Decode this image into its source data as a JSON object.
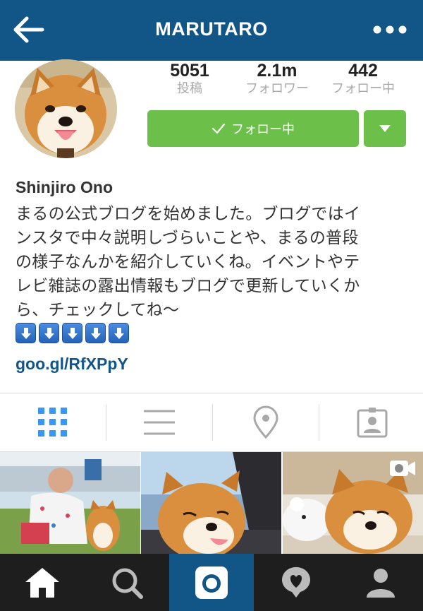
{
  "header": {
    "title": "MARUTARO",
    "back_icon": "arrow-left-icon",
    "more_icon": "more-dots-icon",
    "background": "#125688"
  },
  "profile": {
    "stats": [
      {
        "value": "5051",
        "label": "投稿"
      },
      {
        "value": "2.1m",
        "label": "フォロワー"
      },
      {
        "value": "442",
        "label": "フォロー中"
      }
    ],
    "follow_button": "フォロー中",
    "follow_color": "#6cc04a",
    "name": "Shinjiro Ono",
    "bio_lines": [
      "まるの公式ブログを始めました。ブログではイ",
      "ンスタで中々説明しづらいことや、まるの普段",
      "の様子なんかを紹介していくね。イベントやテ",
      "レビ雑誌の露出情報もブログで更新していくか",
      "ら、チェックしてね〜"
    ],
    "arrow_emoji_count": 5,
    "link": "goo.gl/RfXPpY",
    "link_color": "#125688"
  },
  "view_tabs": [
    {
      "icon": "grid-icon",
      "active": true
    },
    {
      "icon": "list-icon",
      "active": false
    },
    {
      "icon": "location-pin-icon",
      "active": false
    },
    {
      "icon": "tagged-photos-icon",
      "active": false
    }
  ],
  "bottom_nav": [
    {
      "icon": "home-icon",
      "active": false
    },
    {
      "icon": "search-icon",
      "active": false
    },
    {
      "icon": "camera-icon",
      "active": true
    },
    {
      "icon": "activity-heart-icon",
      "active": false
    },
    {
      "icon": "profile-icon",
      "active": false
    }
  ]
}
